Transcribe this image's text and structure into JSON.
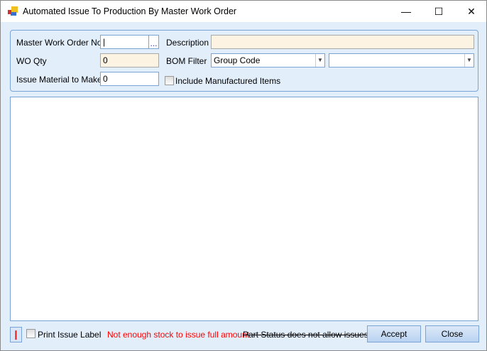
{
  "window": {
    "title": "Automated Issue To Production By Master Work Order"
  },
  "form": {
    "master_wo_label": "Master Work Order No",
    "master_wo_value": "",
    "browse_label": "...",
    "description_label": "Description",
    "description_value": "",
    "wo_qty_label": "WO Qty",
    "wo_qty_value": "0",
    "bom_filter_label": "BOM Filter",
    "bom_filter_value": "Group Code",
    "bom_filter2_value": "",
    "issue_make_label": "Issue Material to Make",
    "issue_make_value": "0",
    "include_manufactured_label": "Include Manufactured Items"
  },
  "footer": {
    "print_label": "Print Issue Label",
    "warning_stock": "Not enough stock to issue full amount",
    "warning_status": "Part Status does not allow issues",
    "accept": "Accept",
    "close": "Close"
  },
  "colors": {
    "warning": "#ff0000",
    "accent": "#7aa3d6"
  }
}
